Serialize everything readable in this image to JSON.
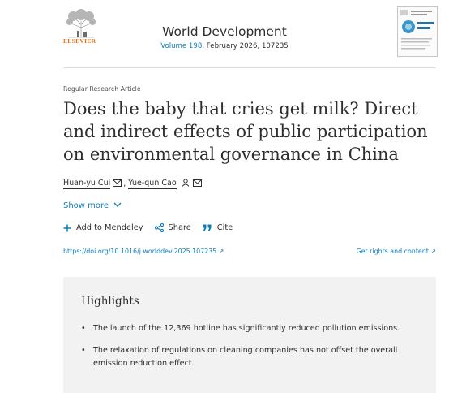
{
  "publisher": {
    "name": "ELSEVIER"
  },
  "journal": {
    "title": "World Development",
    "volume_link": "Volume 198",
    "issue_info": ", February 2026, 107235"
  },
  "article": {
    "type": "Regular Research Article",
    "title": "Does the baby that cries get milk? Direct and indirect effects of public participation on environmental governance in China",
    "authors": [
      {
        "name": "Huan-yu Cui",
        "icons": [
          "mail-icon"
        ]
      },
      {
        "name": "Yue-qun Cao",
        "icons": [
          "person-icon",
          "mail-icon"
        ]
      }
    ],
    "author_separator": ",",
    "show_more": "Show more",
    "doi": "https://doi.org/10.1016/j.worlddev.2025.107235",
    "rights": "Get rights and content"
  },
  "actions": {
    "add_to_mendeley": "Add to Mendeley",
    "share": "Share",
    "cite": "Cite"
  },
  "highlights": {
    "title": "Highlights",
    "items": [
      "The launch of the 12,369 hotline has significantly reduced pollution emissions.",
      "The relaxation of regulations on cleaning companies has not offset the overall emission reduction effect."
    ]
  },
  "colors": {
    "link": "#0c7dbb",
    "brand": "#e9711c",
    "panel": "#f2f2f2"
  }
}
